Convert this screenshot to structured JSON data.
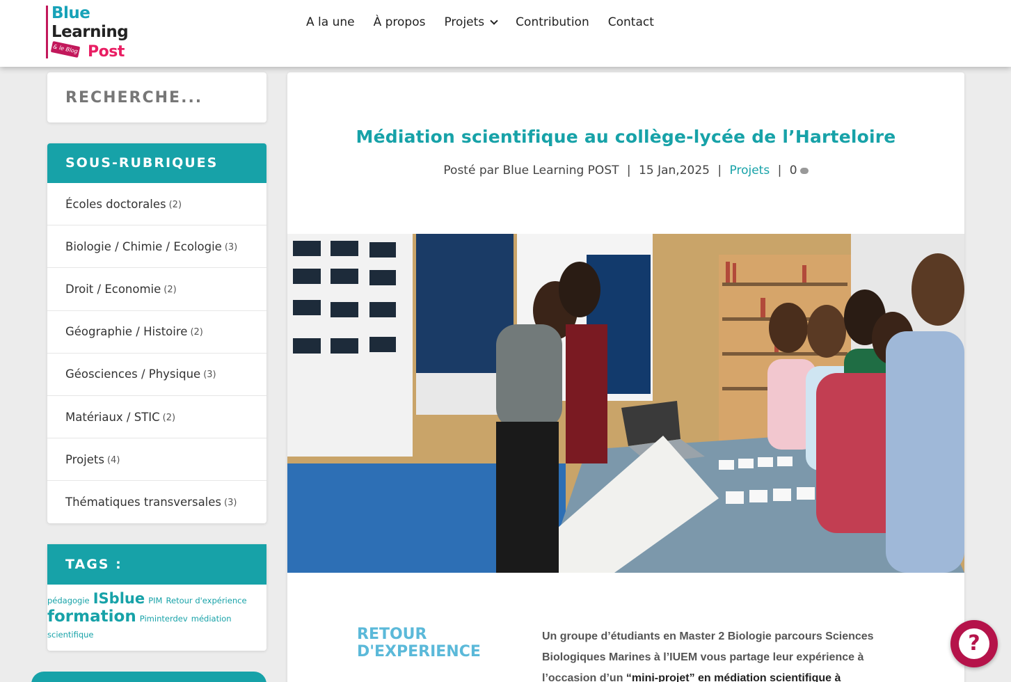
{
  "brand": {
    "line1": "Blue",
    "line2": "Learning",
    "line3": "Post",
    "tag": "& le Blog"
  },
  "nav": {
    "items": [
      {
        "label": "A la une"
      },
      {
        "label": "À propos"
      },
      {
        "label": "Projets",
        "has_dropdown": true
      },
      {
        "label": "Contribution"
      },
      {
        "label": "Contact"
      }
    ]
  },
  "search": {
    "placeholder": "RECHERCHE..."
  },
  "subrubriques": {
    "title": "SOUS-RUBRIQUES",
    "items": [
      {
        "label": "Écoles doctorales",
        "count": "(2)"
      },
      {
        "label": "Biologie / Chimie / Ecologie",
        "count": "(3)"
      },
      {
        "label": "Droit / Economie",
        "count": "(2)"
      },
      {
        "label": "Géographie / Histoire",
        "count": "(2)"
      },
      {
        "label": "Géosciences / Physique",
        "count": "(3)"
      },
      {
        "label": "Matériaux / STIC",
        "count": "(2)"
      },
      {
        "label": "Projets",
        "count": "(4)"
      },
      {
        "label": "Thématiques transversales",
        "count": "(3)"
      }
    ]
  },
  "tags": {
    "title": "TAGS :",
    "items": [
      "pédagogie",
      "ISblue",
      "PIM",
      "Retour d'expérience",
      "formation",
      "Piminterdev",
      "médiation scientifique"
    ]
  },
  "article": {
    "title": "Médiation scientifique au collège-lycée de l’Harteloire",
    "posted_by_prefix": "Posté par",
    "author": "Blue Learning POST",
    "date": "15 Jan,2025",
    "category": "Projets",
    "comments": "0",
    "section_heading": "RETOUR D'EXPERIENCE",
    "intro_text": "Un groupe d’étudiants en Master 2 Biologie parcours Sciences Biologiques Marines à l’IUEM vous partage leur expérience à l’occasion d’un ",
    "intro_link": "“mini-projet” en médiation scientifique à"
  },
  "help": {
    "label": "?"
  },
  "colors": {
    "accent": "#17a2a8",
    "brand_pink": "#c2185b",
    "help_button": "#b5134a"
  }
}
